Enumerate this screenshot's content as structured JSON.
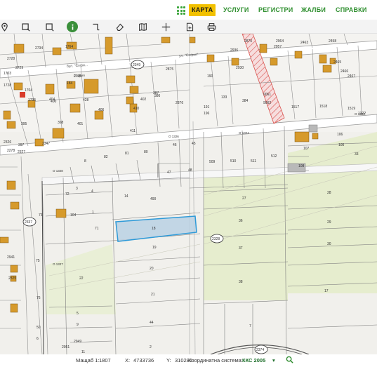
{
  "nav": {
    "items": [
      {
        "label": "КАРТА",
        "active": true
      },
      {
        "label": "УСЛУГИ",
        "active": false
      },
      {
        "label": "РЕГИСТРИ",
        "active": false
      },
      {
        "label": "ЖАЛБИ",
        "active": false
      },
      {
        "label": "СПРАВКИ",
        "active": false
      }
    ]
  },
  "toolbar": {
    "tools": [
      "location-pin-icon",
      "select-rect-icon",
      "zoom-rect-icon",
      "info-icon",
      "measure-line-icon",
      "eraser-icon",
      "map-book-icon",
      "crosshair-icon",
      "document-add-icon",
      "print-icon"
    ]
  },
  "map": {
    "street_labels": [
      "бул. \"Софи...",
      "София",
      "ул. \"София\""
    ],
    "parcel_labels": [
      "2734",
      "1764",
      "2728",
      "2729",
      "1703",
      "1728",
      "1704",
      "184",
      "2735",
      "404",
      "402",
      "406",
      "401",
      "410",
      "411",
      "428",
      "1735",
      "400",
      "395",
      "398",
      "2347",
      "2326",
      "397",
      "2278",
      "2327",
      "386",
      "2875",
      "387",
      "2876",
      "190",
      "133",
      "191",
      "196",
      "2930",
      "2936",
      "2870",
      "384",
      "9061",
      "9062",
      "2964",
      "2957",
      "2463",
      "2458",
      "2465",
      "2466",
      "2467",
      "1517",
      "1518",
      "1519",
      "1322",
      "81",
      "82",
      "8",
      "80",
      "46",
      "45",
      "47",
      "48",
      "14",
      "490",
      "509",
      "510",
      "511",
      "512",
      "106",
      "107",
      "108",
      "33",
      "105",
      "104",
      "27",
      "28",
      "36",
      "29",
      "37",
      "30",
      "38",
      "17",
      "18",
      "19",
      "20",
      "21",
      "44",
      "22",
      "2",
      "3",
      "4",
      "1",
      "71",
      "72",
      "73",
      "75",
      "76",
      "50",
      "6",
      "7",
      "5",
      "9",
      "11",
      "2949",
      "2951",
      "2941",
      "2325"
    ],
    "markers": [
      "О 1326",
      "О 1324",
      "О 1323",
      "О 1328",
      "О 1327"
    ],
    "circled_ids": [
      "2349",
      "2337",
      "2328",
      "2374"
    ]
  },
  "status": {
    "scale_label": "Мащаб 1:",
    "scale_value": "1807",
    "x_label": "X:",
    "x_value": "4733736",
    "y_label": "Y:",
    "y_value": "310285",
    "crs_label": "Координатна система:",
    "crs_value": "ККС 2005"
  },
  "colors": {
    "nav_green": "#2f8f2f",
    "active_yellow": "#f2c100",
    "selected_parcel_fill": "#b7cfe4",
    "selected_parcel_stroke": "#2e9ad8",
    "building_fill": "#d69a2b",
    "meadow_fill": "#e6edce",
    "hatch_red": "#d9534f"
  }
}
